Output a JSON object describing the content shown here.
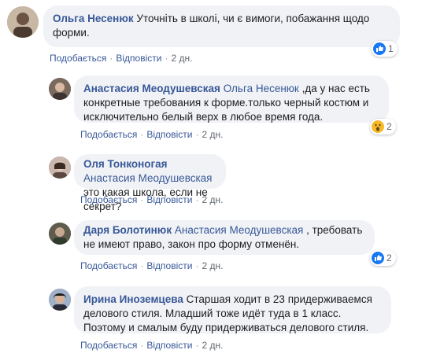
{
  "comments": [
    {
      "author": "Ольга Несенюк",
      "mention": "",
      "text": "Уточніть в школі, чи є вимоги, побажання щодо форми.",
      "actions": {
        "like": "Подобається",
        "reply": "Відповісти",
        "time": "2 дн."
      },
      "reaction": {
        "icon": "like-icon",
        "count": "1"
      }
    },
    {
      "author": "Анастасия Меодушевская",
      "mention": "Ольга Несенюк",
      "text": ",да у нас есть конкретные требования к форме.только черный костюм и исключительно белый верх в любое время года.",
      "actions": {
        "like": "Подобається",
        "reply": "Відповісти",
        "time": "2 дн."
      },
      "reaction": {
        "icon": "wow-icon",
        "count": "2"
      }
    },
    {
      "author": "Оля Тонконогая",
      "mention": "Анастасия Меодушевская",
      "text": "это какая школа, если не секрет?",
      "actions": {
        "like": "Подобається",
        "reply": "Відповісти",
        "time": "2 дн."
      }
    },
    {
      "author": "Даря Болотинюк",
      "mention": "Анастасия Меодушевская",
      "text": ", требовать не имеют право, закон про форму отменён.",
      "actions": {
        "like": "Подобається",
        "reply": "Відповісти",
        "time": "2 дн."
      },
      "reaction": {
        "icon": "like-icon",
        "count": "2"
      }
    },
    {
      "author": "Ирина Иноземцева",
      "mention": "",
      "text": "Старшая ходит в 23 придерживаемся делового стиля. Младший тоже идёт туда в 1 класс. Поэтому и смалым буду придерживаться делового стиля.",
      "actions": {
        "like": "Подобається",
        "reply": "Відповісти",
        "time": "2 дн."
      }
    }
  ],
  "colors": {
    "link": "#385898",
    "bubble": "#f0f2f5",
    "like": "#1877f2",
    "wow": "#f7b928"
  }
}
